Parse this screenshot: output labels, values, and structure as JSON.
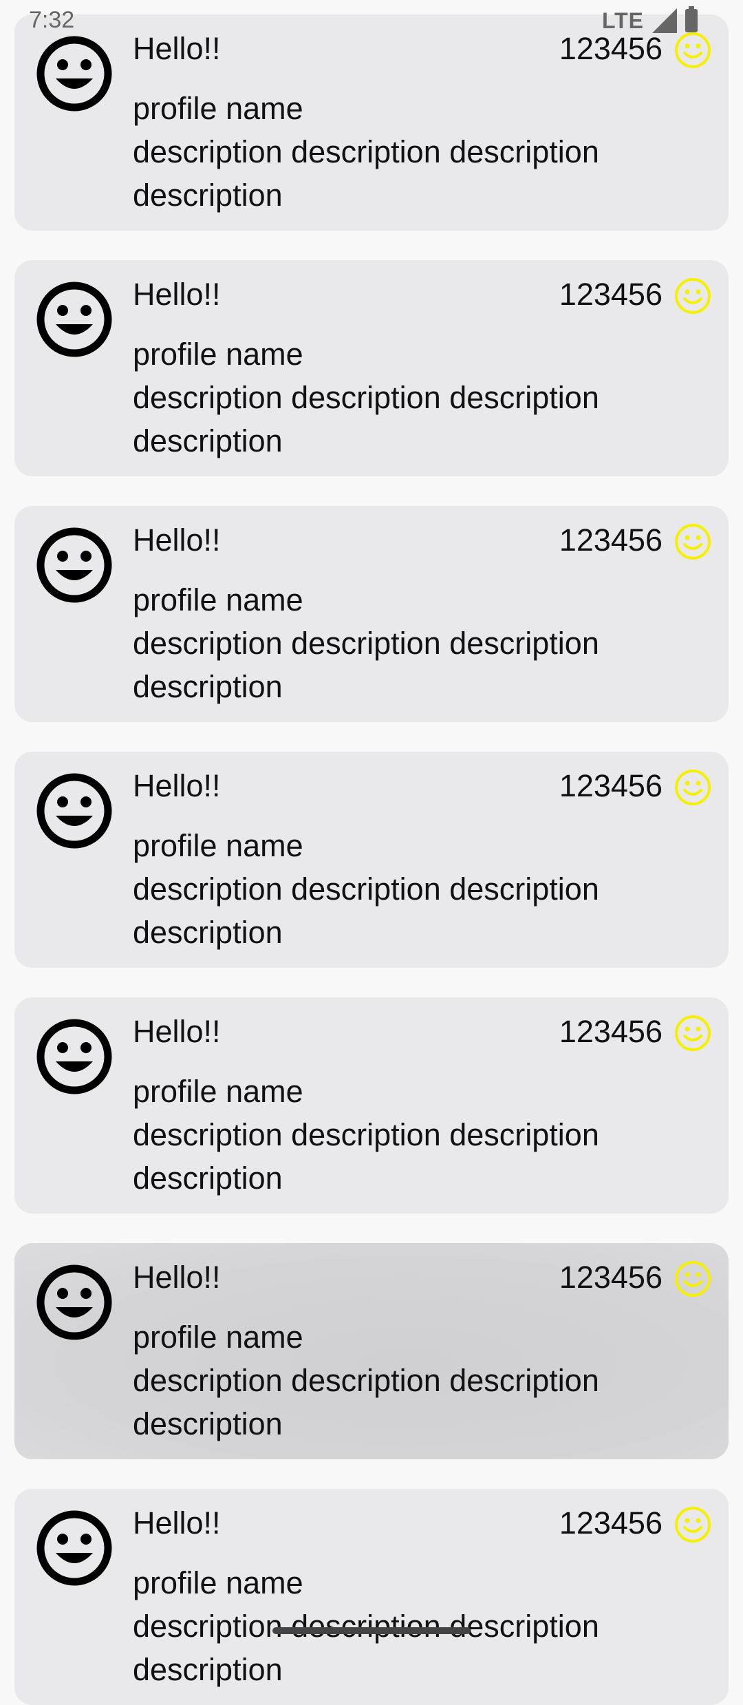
{
  "status_bar": {
    "time": "7:32",
    "network": "LTE"
  },
  "colors": {
    "card_background": "#e9e9eb",
    "pressed_card_background": "#d2d2d4",
    "accent_smiley": "#f5f000",
    "avatar": "#000000"
  },
  "cards": [
    {
      "title": "Hello!!",
      "number": "123456",
      "profile_name": "profile name",
      "description_1": "description description description",
      "description_2": "description",
      "avatar_icon": "smiley-face-icon",
      "status_icon": "yellow-smiley-icon"
    },
    {
      "title": "Hello!!",
      "number": "123456",
      "profile_name": "profile name",
      "description_1": "description description description",
      "description_2": "description",
      "avatar_icon": "smiley-face-icon",
      "status_icon": "yellow-smiley-icon"
    },
    {
      "title": "Hello!!",
      "number": "123456",
      "profile_name": "profile name",
      "description_1": "description description description",
      "description_2": "description",
      "avatar_icon": "smiley-face-icon",
      "status_icon": "yellow-smiley-icon"
    },
    {
      "title": "Hello!!",
      "number": "123456",
      "profile_name": "profile name",
      "description_1": "description description description",
      "description_2": "description",
      "avatar_icon": "smiley-face-icon",
      "status_icon": "yellow-smiley-icon"
    },
    {
      "title": "Hello!!",
      "number": "123456",
      "profile_name": "profile name",
      "description_1": "description description description",
      "description_2": "description",
      "avatar_icon": "smiley-face-icon",
      "status_icon": "yellow-smiley-icon"
    },
    {
      "title": "Hello!!",
      "number": "123456",
      "profile_name": "profile name",
      "description_1": "description description description",
      "description_2": "description",
      "avatar_icon": "smiley-face-icon",
      "status_icon": "yellow-smiley-icon",
      "pressed": true
    },
    {
      "title": "Hello!!",
      "number": "123456",
      "profile_name": "profile name",
      "description_1": "description description description",
      "description_2": "description",
      "avatar_icon": "smiley-face-icon",
      "status_icon": "yellow-smiley-icon"
    }
  ]
}
